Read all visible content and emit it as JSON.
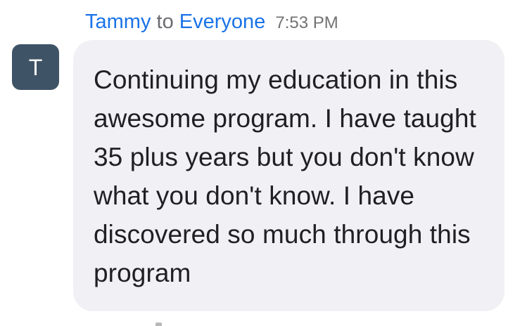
{
  "chat": {
    "sender": "Tammy",
    "to": "to",
    "recipient": "Everyone",
    "time": "7:53 PM",
    "avatar_initial": "T",
    "message": "Continuing my education in this awesome program. I have taught 35 plus years but you don't know what you don't know. I have discovered so much through this program"
  },
  "colors": {
    "sender": "#1a73e8",
    "avatar_bg": "#3f5366",
    "bubble_bg": "#f1f1f5",
    "message_text": "#1f1f24"
  },
  "icons": {
    "avatar": "avatar-initial"
  }
}
